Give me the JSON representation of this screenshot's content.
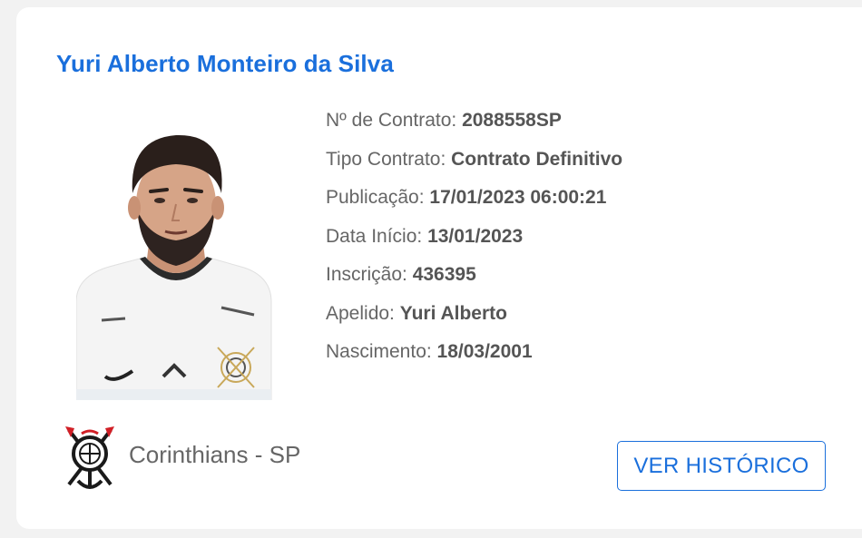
{
  "player": {
    "name": "Yuri Alberto Monteiro da Silva",
    "photo_alt": "Yuri Alberto"
  },
  "details": [
    {
      "label": "Nº de Contrato: ",
      "value": "2088558SP"
    },
    {
      "label": "Tipo Contrato: ",
      "value": "Contrato Definitivo"
    },
    {
      "label": "Publicação: ",
      "value": "17/01/2023 06:00:21"
    },
    {
      "label": "Data Início: ",
      "value": "13/01/2023"
    },
    {
      "label": "Inscrição: ",
      "value": "436395"
    },
    {
      "label": "Apelido: ",
      "value": "Yuri Alberto"
    },
    {
      "label": "Nascimento: ",
      "value": "18/03/2001"
    }
  ],
  "club": {
    "name": "Corinthians - SP",
    "crest_icon": "corinthians-crest-icon"
  },
  "actions": {
    "history_label": "VER HISTÓRICO"
  },
  "colors": {
    "accent": "#1a6fdc",
    "text": "#666666",
    "background": "#f2f2f2",
    "card": "#ffffff"
  }
}
